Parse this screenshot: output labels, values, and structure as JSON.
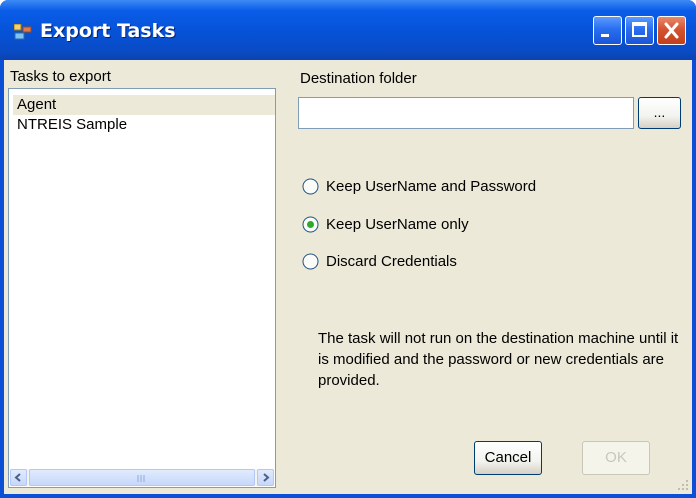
{
  "window": {
    "title": "Export Tasks",
    "colors": {
      "titlebar": "#0552d6",
      "client": "#ece9d8"
    },
    "icons": [
      "app-icon",
      "minimize-icon",
      "maximize-icon",
      "close-icon"
    ]
  },
  "tasks": {
    "label": "Tasks to export",
    "items": [
      "Agent",
      "NTREIS Sample"
    ],
    "selected": "Agent"
  },
  "destination": {
    "label": "Destination folder",
    "value": "",
    "browse_label": "..."
  },
  "credentials": {
    "options": [
      "Keep UserName and Password",
      "Keep UserName only",
      "Discard Credentials"
    ],
    "selected_index": 1
  },
  "info_text": "The task will not run on the destination machine until it is modified and the password or new credentials are provided.",
  "buttons": {
    "cancel": "Cancel",
    "ok": "OK"
  },
  "scrollbar": {
    "grip_label": "III"
  }
}
